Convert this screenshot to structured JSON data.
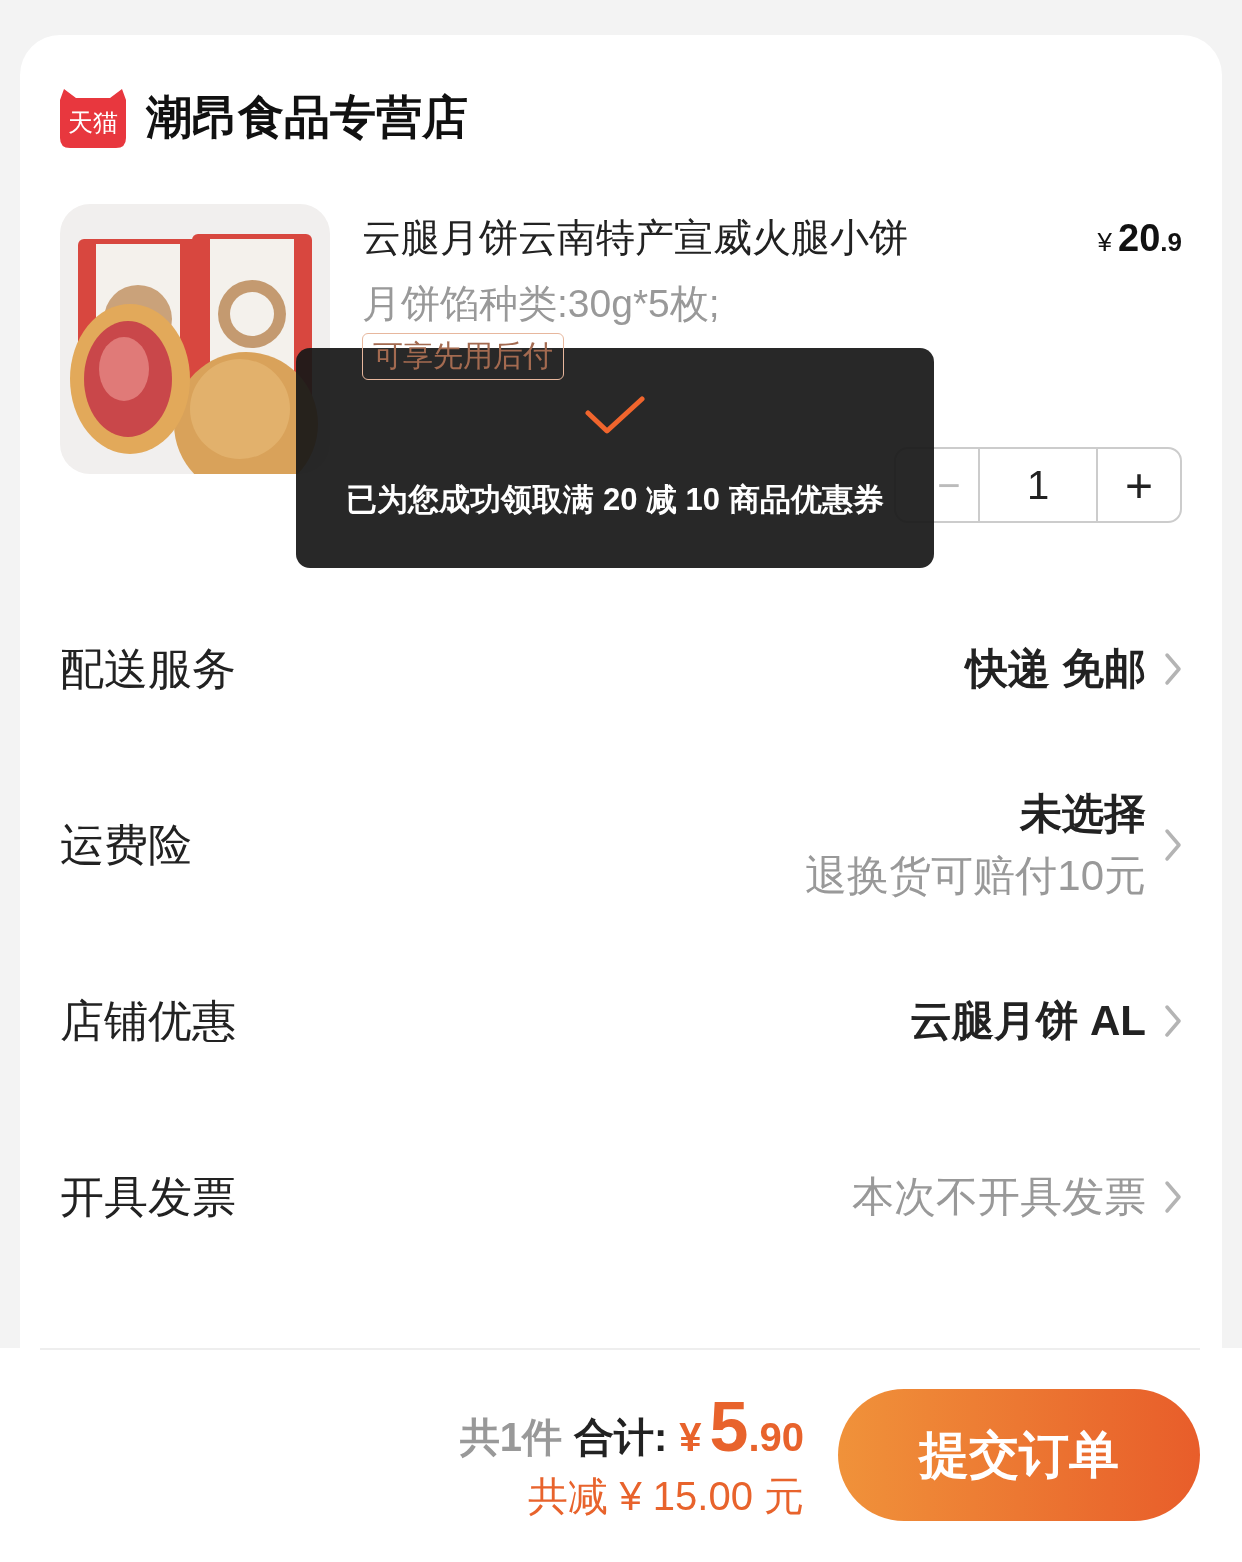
{
  "shop": {
    "badge": "天猫",
    "name": "潮昂食品专营店"
  },
  "product": {
    "title": "云腿月饼云南特产宣威火腿小饼",
    "spec": "月饼馅种类:30g*5枚;",
    "tag": "可享先用后付",
    "price": {
      "currency": "¥",
      "integer": "20",
      "decimal": ".9"
    },
    "stepper": {
      "minus": "−",
      "quantity": "1",
      "plus": "+"
    }
  },
  "options": [
    {
      "label": "配送服务",
      "value": "快递 免邮",
      "muted": false
    },
    {
      "label": "运费险",
      "value": "未选择",
      "note": "退换货可赔付10元",
      "muted": false
    },
    {
      "label": "店铺优惠",
      "value": "云腿月饼 AL",
      "muted": false
    },
    {
      "label": "开具发票",
      "value": "本次不开具发票",
      "muted": true
    }
  ],
  "toast": {
    "message": "已为您成功领取满 20 减 10 商品优惠券"
  },
  "checkout": {
    "count": "共1件",
    "total_label": "合计:",
    "currency": "¥",
    "integer": "5",
    "decimal": ".90",
    "discount": "共减 ¥ 15.00 元",
    "submit": "提交订单"
  }
}
